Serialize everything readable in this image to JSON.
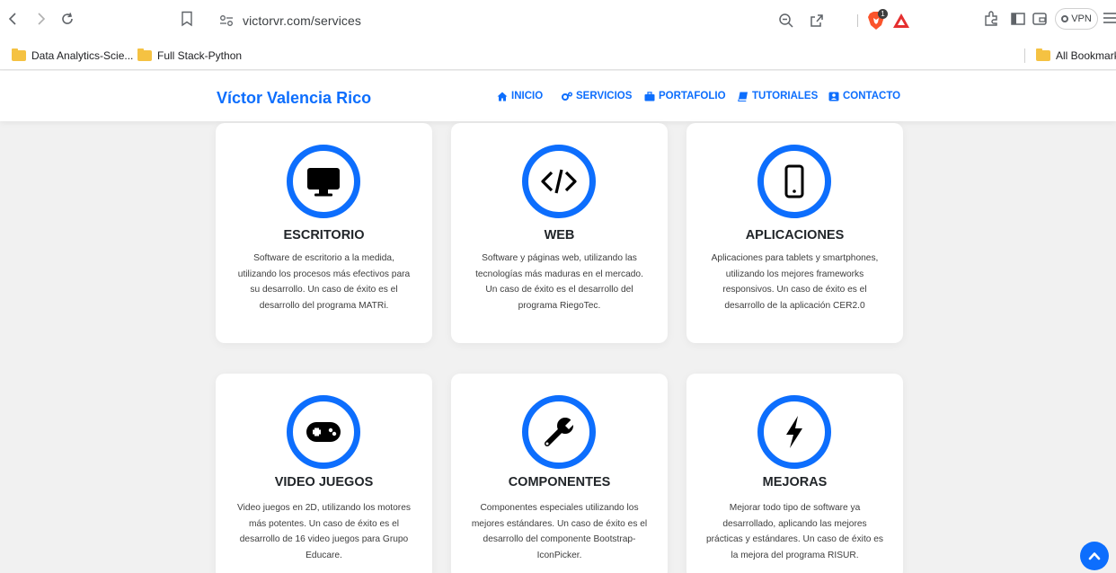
{
  "browser": {
    "url": "victorvr.com/services",
    "brave_badge_count": "1",
    "vpn_label": "VPN",
    "bookmarks": [
      {
        "label": "Data Analytics-Scie...",
        "icon": "folder-icon"
      },
      {
        "label": "Full Stack-Python",
        "icon": "folder-icon"
      }
    ],
    "all_bookmarks_label": "All Bookmarks"
  },
  "site": {
    "brand": "Víctor Valencia Rico",
    "nav": [
      {
        "label": "INICIO",
        "icon": "home-icon"
      },
      {
        "label": "SERVICIOS",
        "icon": "cogs-icon"
      },
      {
        "label": "PORTAFOLIO",
        "icon": "briefcase-icon"
      },
      {
        "label": "TUTORIALES",
        "icon": "book-icon"
      },
      {
        "label": "CONTACTO",
        "icon": "contact-card-icon"
      }
    ],
    "accent_color": "#0d6efd"
  },
  "services": [
    {
      "title": "ESCRITORIO",
      "icon": "desktop-monitor-icon",
      "lines": [
        "Software de escritorio a la medida,",
        "utilizando los procesos más efectivos para",
        "su desarrollo. Un caso de éxito es el",
        "desarrollo del programa MATRi."
      ]
    },
    {
      "title": "WEB",
      "icon": "code-icon",
      "lines": [
        "Software y páginas web, utilizando las",
        "tecnologías más maduras en el mercado.",
        "Un caso de éxito es el desarrollo del",
        "programa RiegoTec."
      ]
    },
    {
      "title": "APLICACIONES",
      "icon": "mobile-phone-icon",
      "lines": [
        "Aplicaciones para tablets y smartphones,",
        "utilizando los mejores frameworks",
        "responsivos. Un caso de éxito es el",
        "desarrollo de la aplicación CER2.0"
      ]
    },
    {
      "title": "VIDEO JUEGOS",
      "icon": "gamepad-icon",
      "lines": [
        "Video juegos en 2D, utilizando los motores",
        "más potentes. Un caso de éxito es el",
        "desarrollo de 16 video juegos para Grupo",
        "Educare."
      ]
    },
    {
      "title": "COMPONENTES",
      "icon": "wrench-icon",
      "lines": [
        "Componentes especiales utilizando los",
        "mejores estándares. Un caso de éxito es el",
        "desarrollo del componente Bootstrap-",
        "IconPicker."
      ]
    },
    {
      "title": "MEJORAS",
      "icon": "lightning-bolt-icon",
      "lines": [
        "Mejorar todo tipo de software ya",
        "desarrollado, aplicando las mejores",
        "prácticas y estándares. Un caso de éxito es",
        "la mejora del programa RISUR."
      ]
    }
  ]
}
